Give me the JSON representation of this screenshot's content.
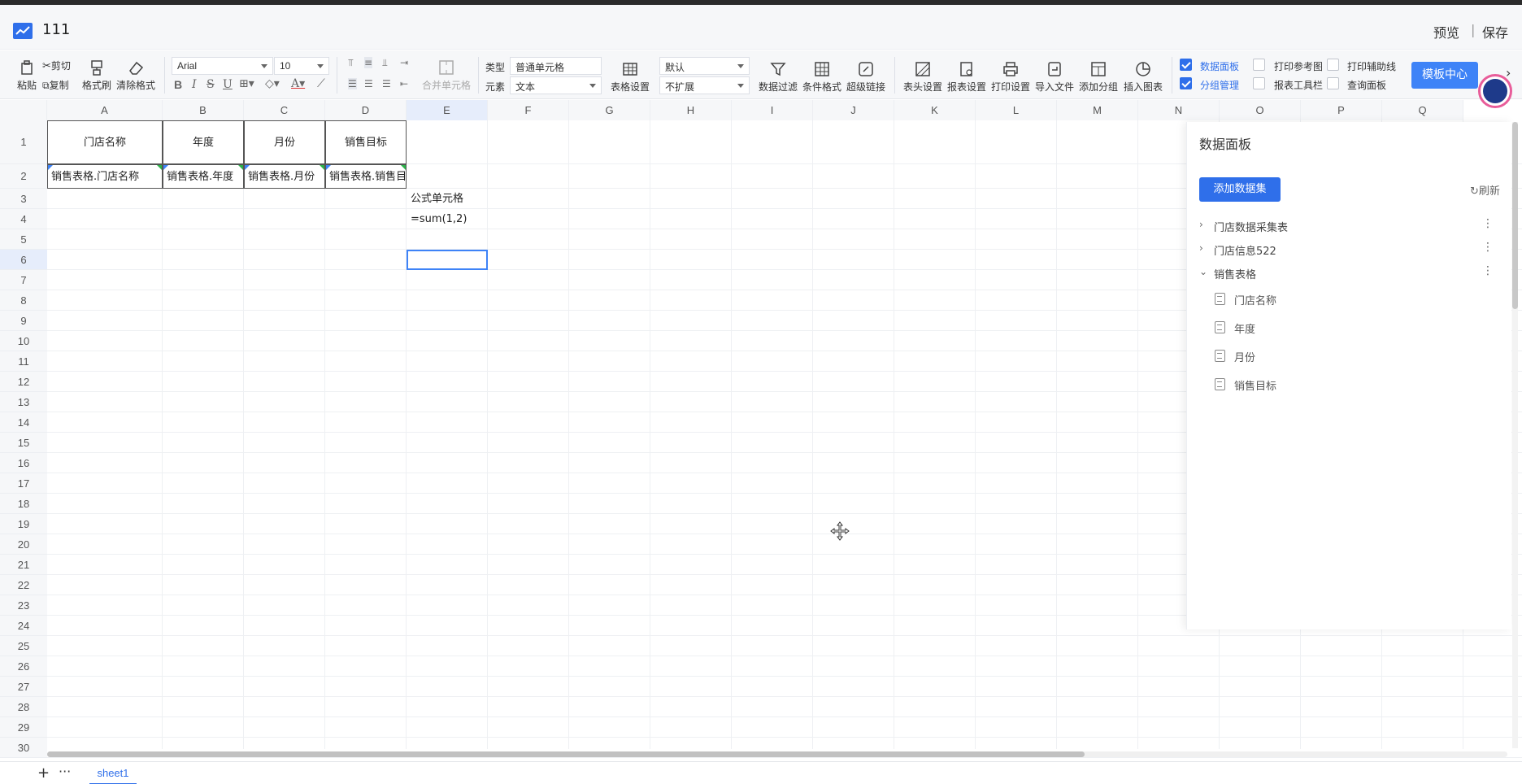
{
  "titlebar": {
    "title": "111",
    "preview": "预览",
    "separator": "|",
    "save": "保存"
  },
  "toolbar": {
    "paste": "粘贴",
    "cut": "剪切",
    "copy": "复制",
    "format_painter": "格式刷",
    "clear_format": "清除格式",
    "font_name": "Arial",
    "font_size": "10",
    "merge_cells": "合并单元格",
    "type_label": "类型",
    "type_value": "普通单元格",
    "element_label": "元素",
    "element_value": "文本",
    "table_settings": "表格设置",
    "default_value": "默认",
    "expand_value": "不扩展",
    "data_filter": "数据过滤",
    "conditional_format": "条件格式",
    "hyperlink": "超级链接",
    "header_settings": "表头设置",
    "report_settings": "报表设置",
    "print_settings": "打印设置",
    "import_file": "导入文件",
    "add_group": "添加分组",
    "insert_chart": "插入图表",
    "data_panel": "数据面板",
    "group_manage": "分组管理",
    "print_ref": "打印参考图",
    "report_toolbar": "报表工具栏",
    "print_guides": "打印辅助线",
    "query_panel": "查询面板",
    "template_center": "模板中心"
  },
  "columns": [
    "A",
    "B",
    "C",
    "D",
    "E",
    "F",
    "G",
    "H",
    "I",
    "J",
    "K",
    "L",
    "M",
    "N",
    "O",
    "P",
    "Q"
  ],
  "rows": [
    "1",
    "2",
    "3",
    "4",
    "5",
    "6",
    "7",
    "8",
    "9",
    "10",
    "11",
    "12",
    "13",
    "14",
    "15",
    "16",
    "17",
    "18",
    "19",
    "20",
    "21",
    "22",
    "23",
    "24",
    "25",
    "26",
    "27",
    "28",
    "29",
    "30"
  ],
  "cells": {
    "A1": "门店名称",
    "B1": "年度",
    "C1": "月份",
    "D1": "销售目标",
    "A2": "销售表格.门店名称",
    "B2": "销售表格.年度",
    "C2": "销售表格.月份",
    "D2": "销售表格.销售目标",
    "E3": "公式单元格",
    "E4": "=sum(1,2)"
  },
  "panel": {
    "title": "数据面板",
    "add_dataset": "添加数据集",
    "refresh": "刷新",
    "datasets": [
      "门店数据采集表",
      "门店信息522",
      "销售表格"
    ],
    "fields": [
      "门店名称",
      "年度",
      "月份",
      "销售目标"
    ]
  },
  "sheetbar": {
    "add": "+",
    "more": "···",
    "tab": "sheet1"
  },
  "colors": {
    "accent": "#2f6fea",
    "button": "#3e83f7"
  }
}
